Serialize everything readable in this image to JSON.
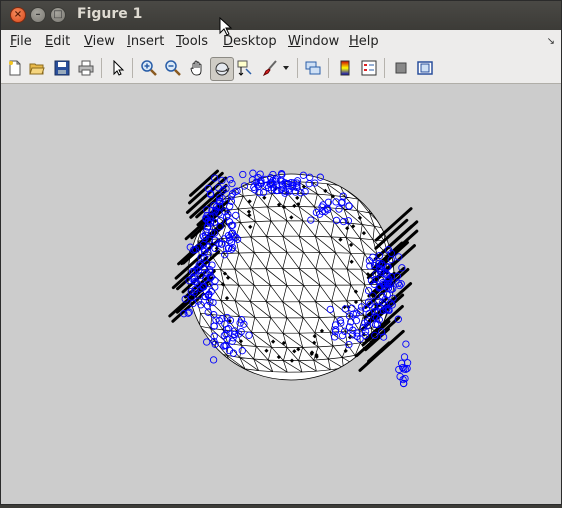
{
  "window": {
    "title": "Figure 1",
    "controls": [
      "close",
      "minimize",
      "maximize"
    ]
  },
  "menubar": {
    "items": [
      {
        "label": "File",
        "mnemonic": "F",
        "rest": "ile"
      },
      {
        "label": "Edit",
        "mnemonic": "E",
        "rest": "dit"
      },
      {
        "label": "View",
        "mnemonic": "V",
        "rest": "iew"
      },
      {
        "label": "Insert",
        "mnemonic": "I",
        "rest": "nsert"
      },
      {
        "label": "Tools",
        "mnemonic": "T",
        "rest": "ools"
      },
      {
        "label": "Desktop",
        "mnemonic": "D",
        "rest": "esktop"
      },
      {
        "label": "Window",
        "mnemonic": "W",
        "rest": "indow"
      },
      {
        "label": "Help",
        "mnemonic": "H",
        "rest": "elp"
      }
    ],
    "overflow_icon": "undock-arrow-icon"
  },
  "toolbar": {
    "buttons": [
      "new-figure-icon",
      "open-file-icon",
      "save-figure-icon",
      "print-figure-icon",
      "edit-plot-arrow-icon",
      "zoom-in-icon",
      "zoom-out-icon",
      "pan-hand-icon",
      "rotate-3d-icon",
      "data-cursor-icon",
      "brush-icon",
      "brush-dropdown-icon",
      "link-plot-icon",
      "insert-colorbar-icon",
      "insert-legend-icon",
      "hide-plot-tools-icon",
      "show-plot-tools-icon"
    ],
    "pressed": "rotate-3d-icon"
  },
  "figure": {
    "background": "#cccccc",
    "marker_color": "#0000ff",
    "mesh_color": "#000000",
    "sphere_fill": "#ffffff"
  }
}
